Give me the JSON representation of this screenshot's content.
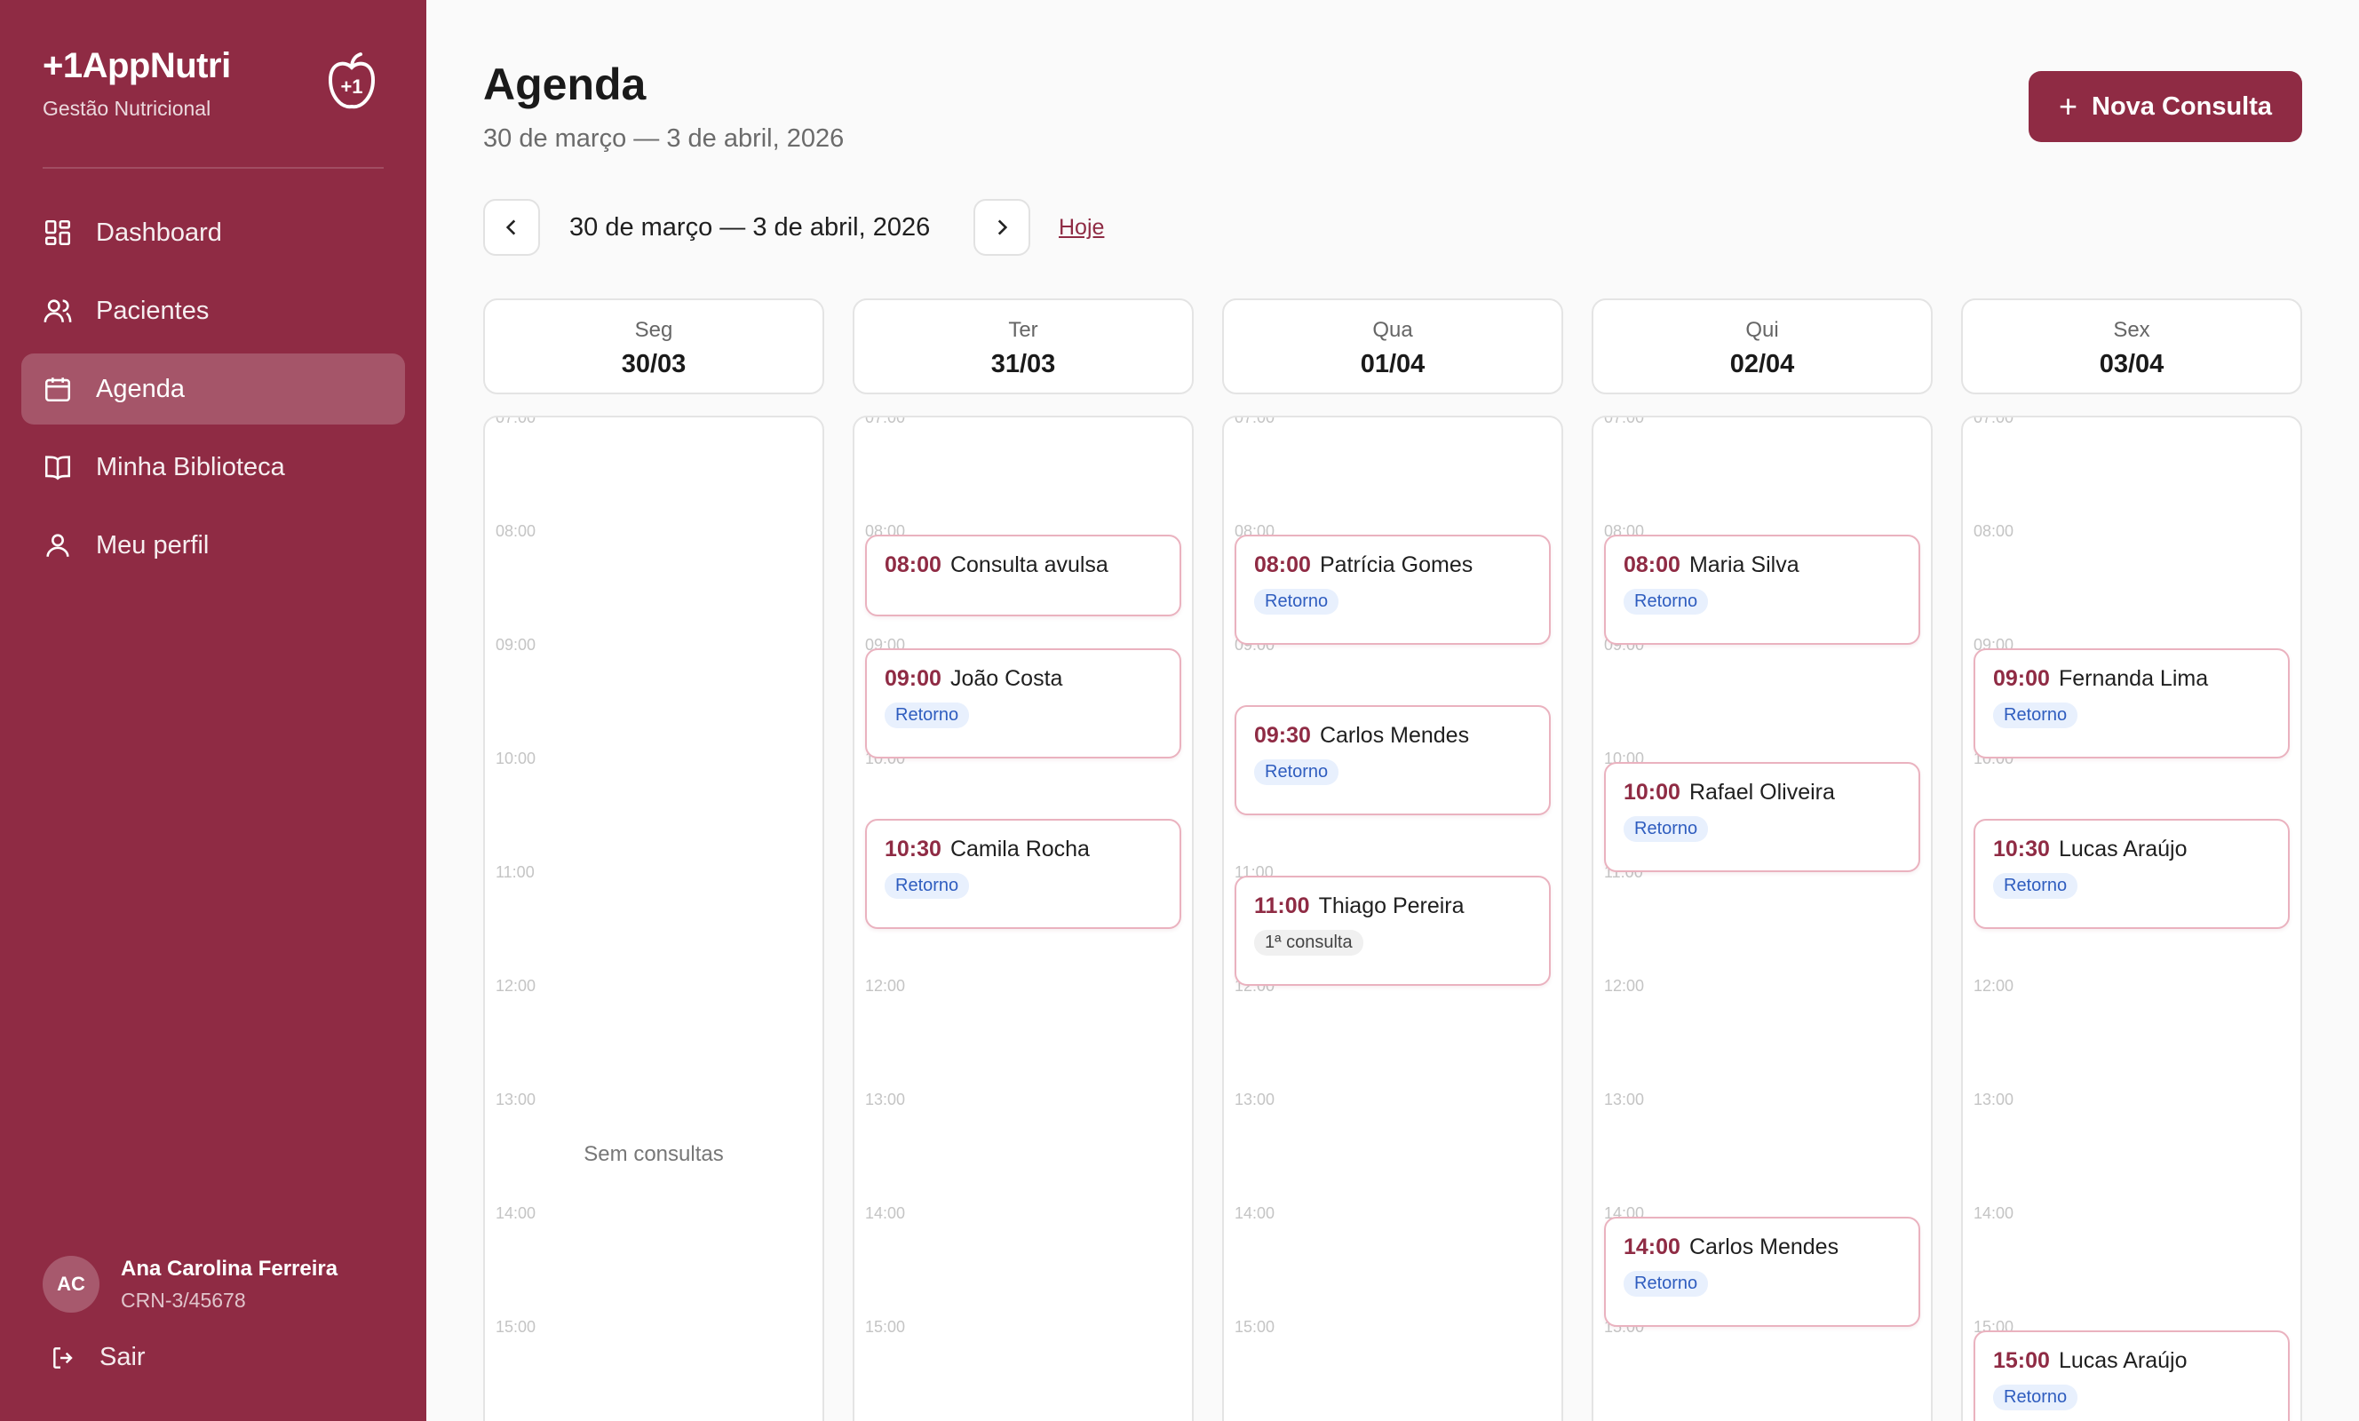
{
  "sidebar": {
    "brand_name": "+1AppNutri",
    "brand_sub": "Gestão Nutricional",
    "logo_text": "+1",
    "items": [
      {
        "label": "Dashboard",
        "icon": "dashboard-icon"
      },
      {
        "label": "Pacientes",
        "icon": "users-icon"
      },
      {
        "label": "Agenda",
        "icon": "calendar-icon",
        "active": true
      },
      {
        "label": "Minha Biblioteca",
        "icon": "book-icon"
      },
      {
        "label": "Meu perfil",
        "icon": "user-icon"
      }
    ],
    "user": {
      "initials": "AC",
      "name": "Ana Carolina Ferreira",
      "crn": "CRN-3/45678"
    },
    "logout_label": "Sair"
  },
  "header": {
    "title": "Agenda",
    "subtitle": "30 de março — 3 de abril, 2026",
    "new_button": "Nova Consulta"
  },
  "week_nav": {
    "range": "30 de março — 3 de abril, 2026",
    "today": "Hoje"
  },
  "hours": [
    "07:00",
    "08:00",
    "09:00",
    "10:00",
    "11:00",
    "12:00",
    "13:00",
    "14:00",
    "15:00"
  ],
  "days": [
    {
      "name": "Seg",
      "date": "30/03",
      "empty": "Sem consultas",
      "appointments": []
    },
    {
      "name": "Ter",
      "date": "31/03",
      "appointments": [
        {
          "time": "08:00",
          "name": "Consulta avulsa",
          "tag": ""
        },
        {
          "time": "09:00",
          "name": "João Costa",
          "tag": "Retorno"
        },
        {
          "time": "10:30",
          "name": "Camila Rocha",
          "tag": "Retorno"
        }
      ]
    },
    {
      "name": "Qua",
      "date": "01/04",
      "appointments": [
        {
          "time": "08:00",
          "name": "Patrícia Gomes",
          "tag": "Retorno"
        },
        {
          "time": "09:30",
          "name": "Carlos Mendes",
          "tag": "Retorno"
        },
        {
          "time": "11:00",
          "name": "Thiago Pereira",
          "tag": "1ª consulta"
        }
      ]
    },
    {
      "name": "Qui",
      "date": "02/04",
      "appointments": [
        {
          "time": "08:00",
          "name": "Maria Silva",
          "tag": "Retorno"
        },
        {
          "time": "10:00",
          "name": "Rafael Oliveira",
          "tag": "Retorno"
        },
        {
          "time": "14:00",
          "name": "Carlos Mendes",
          "tag": "Retorno"
        }
      ]
    },
    {
      "name": "Sex",
      "date": "03/04",
      "appointments": [
        {
          "time": "09:00",
          "name": "Fernanda Lima",
          "tag": "Retorno"
        },
        {
          "time": "10:30",
          "name": "Lucas Araújo",
          "tag": "Retorno"
        },
        {
          "time": "15:00",
          "name": "Lucas Araújo",
          "tag": "Retorno"
        }
      ]
    }
  ],
  "colors": {
    "brand": "#8f2b44",
    "tag_blue": "#2f5dbf",
    "border_pink": "#eab2bf"
  }
}
